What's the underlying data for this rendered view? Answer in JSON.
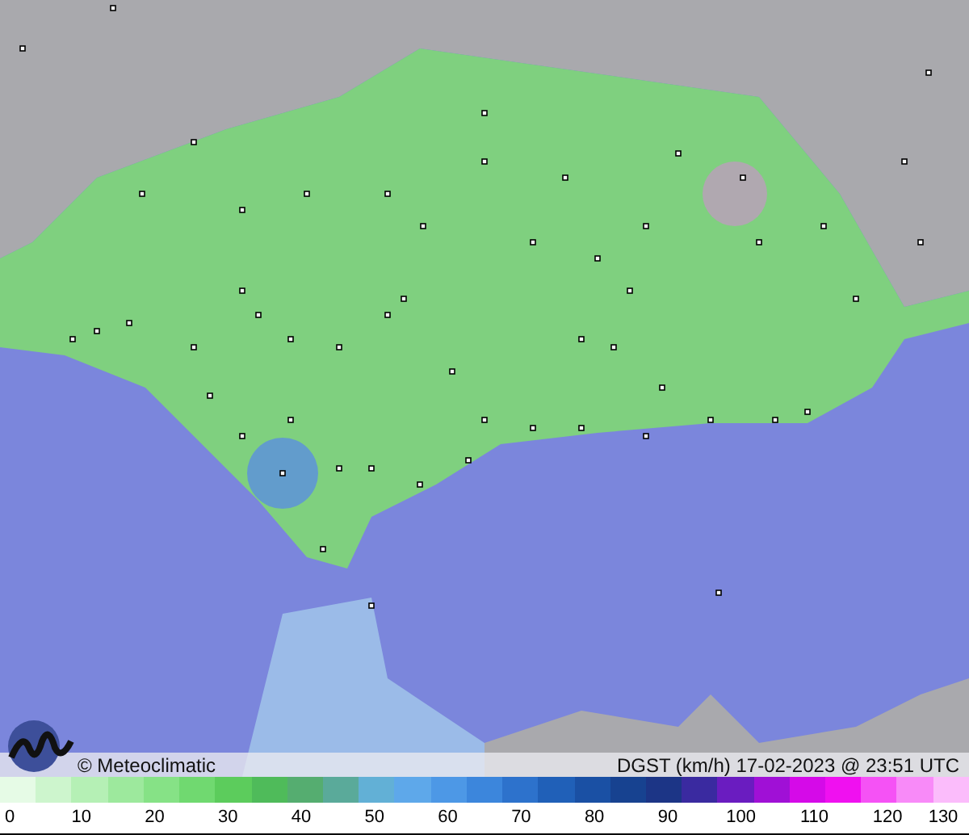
{
  "map": {
    "credit": "© Meteoclimatic",
    "caption": "DGST (km/h)  17-02-2023 @ 23:51 UTC"
  },
  "scale": {
    "swatches": [
      {
        "color": "#e6fbe6"
      },
      {
        "color": "#cdf5cd"
      },
      {
        "color": "#b5f0b5"
      },
      {
        "color": "#9de99d"
      },
      {
        "color": "#86e286"
      },
      {
        "color": "#70d970"
      },
      {
        "color": "#5ccc5c"
      },
      {
        "color": "#4fbb5a"
      },
      {
        "color": "#55ad70"
      },
      {
        "color": "#5aaa9a"
      },
      {
        "color": "#62b0d6"
      },
      {
        "color": "#5ea8ea"
      },
      {
        "color": "#4d98e6"
      },
      {
        "color": "#3c86dc"
      },
      {
        "color": "#2d72cc"
      },
      {
        "color": "#2060b8"
      },
      {
        "color": "#1a50a4"
      },
      {
        "color": "#174290"
      },
      {
        "color": "#1c3586"
      },
      {
        "color": "#3a2aa0"
      },
      {
        "color": "#6a1cc0"
      },
      {
        "color": "#a010d6"
      },
      {
        "color": "#d50ae8"
      },
      {
        "color": "#f010f0"
      },
      {
        "color": "#f552f5"
      },
      {
        "color": "#f88af8"
      },
      {
        "color": "#fbbcfb"
      }
    ],
    "ticks": [
      "0",
      "10",
      "20",
      "30",
      "40",
      "50",
      "60",
      "70",
      "80",
      "90",
      "100",
      "110",
      "120",
      "130"
    ]
  }
}
